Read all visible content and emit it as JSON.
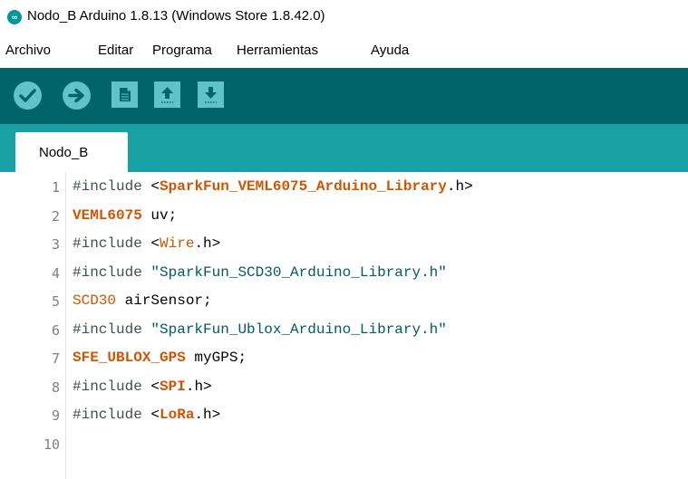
{
  "window": {
    "title": "Nodo_B Arduino 1.8.13 (Windows Store 1.8.42.0)",
    "icon": "arduino-logo-icon",
    "icon_glyph": "∞"
  },
  "menu": {
    "items": [
      "Archivo",
      "Editar",
      "Programa",
      "Herramientas",
      "Ayuda"
    ]
  },
  "toolbar": {
    "buttons": [
      {
        "name": "verify-button",
        "icon": "checkmark-icon"
      },
      {
        "name": "upload-button",
        "icon": "arrow-right-icon"
      },
      {
        "name": "new-button",
        "icon": "new-file-icon"
      },
      {
        "name": "open-button",
        "icon": "arrow-up-icon"
      },
      {
        "name": "save-button",
        "icon": "arrow-down-icon"
      }
    ],
    "colors": {
      "background": "#006468",
      "button": "#5fc4c8"
    }
  },
  "tabs": [
    {
      "label": "Nodo_B",
      "active": true
    }
  ],
  "editor": {
    "lines": [
      {
        "num": "1",
        "tokens": [
          [
            "preproc",
            "#include "
          ],
          [
            "plain",
            "<"
          ],
          [
            "type-bold",
            "SparkFun_VEML6075_Arduino_Library"
          ],
          [
            "plain",
            ".h>"
          ]
        ]
      },
      {
        "num": "2",
        "tokens": [
          [
            "type-bold",
            "VEML6075"
          ],
          [
            "plain",
            " uv;"
          ]
        ]
      },
      {
        "num": "3",
        "tokens": [
          [
            "preproc",
            "#include "
          ],
          [
            "plain",
            "<"
          ],
          [
            "type",
            "Wire"
          ],
          [
            "plain",
            ".h>"
          ]
        ]
      },
      {
        "num": "4",
        "tokens": [
          [
            "preproc",
            "#include "
          ],
          [
            "string",
            "\"SparkFun_SCD30_Arduino_Library.h\""
          ]
        ]
      },
      {
        "num": "5",
        "tokens": [
          [
            "type",
            "SCD30"
          ],
          [
            "plain",
            " airSensor;"
          ]
        ]
      },
      {
        "num": "6",
        "tokens": [
          [
            "preproc",
            "#include "
          ],
          [
            "string",
            "\"SparkFun_Ublox_Arduino_Library.h\""
          ]
        ]
      },
      {
        "num": "7",
        "tokens": [
          [
            "type-bold",
            "SFE_UBLOX_GPS"
          ],
          [
            "plain",
            " myGPS;"
          ]
        ]
      },
      {
        "num": "8",
        "tokens": [
          [
            "preproc",
            "#include "
          ],
          [
            "plain",
            "<"
          ],
          [
            "type-bold",
            "SPI"
          ],
          [
            "plain",
            ".h>"
          ]
        ]
      },
      {
        "num": "9",
        "tokens": [
          [
            "preproc",
            "#include "
          ],
          [
            "plain",
            "<"
          ],
          [
            "type-bold",
            "LoRa"
          ],
          [
            "plain",
            ".h>"
          ]
        ]
      },
      {
        "num": "10",
        "tokens": []
      }
    ]
  }
}
